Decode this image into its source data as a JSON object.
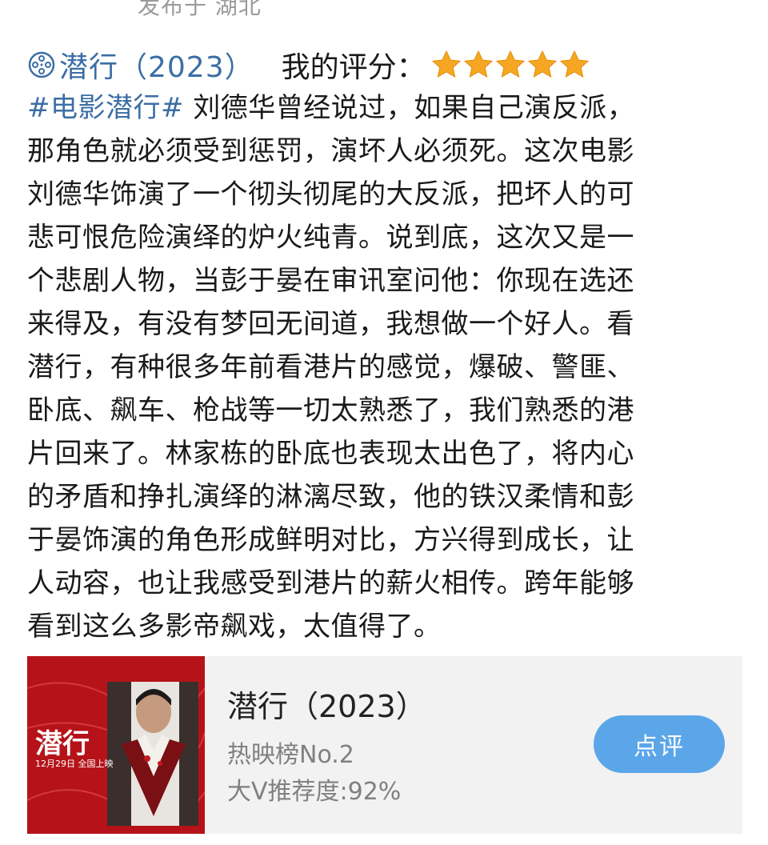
{
  "header": {
    "posted_from": "发布于 湖北"
  },
  "rating": {
    "film_icon": "film-reel-icon",
    "movie_link": "潜行（2023）",
    "score_label": "我的评分：",
    "stars": 5,
    "star_color": "#f5a623"
  },
  "post": {
    "hashtag": "#电影潜行#",
    "lines": [
      " 刘德华曾经说过，如果自己演反派，",
      "那角色就必须受到惩罚，演坏人必须死。这次电影",
      "刘德华饰演了一个彻头彻尾的大反派，把坏人的可",
      "悲可恨危险演绎的炉火纯青。说到底，这次又是一",
      "个悲剧人物，当彭于晏在审讯室问他：你现在选还",
      "来得及，有没有梦回无间道，我想做一个好人。看",
      "潜行，有种很多年前看港片的感觉，爆破、警匪、",
      "卧底、飙车、枪战等一切太熟悉了，我们熟悉的港",
      "片回来了。林家栋的卧底也表现太出色了，将内心",
      "的矛盾和挣扎演绎的淋漓尽致，他的铁汉柔情和彭",
      "于晏饰演的角色形成鲜明对比，方兴得到成长，让",
      "人动容，也让我感受到港片的薪火相传。跨年能够",
      "看到这么多影帝飙戏，太值得了。"
    ]
  },
  "card": {
    "poster_title": "潜行",
    "poster_date": "12月29日 全国上映",
    "title": "潜行（2023）",
    "rank": "热映榜No.2",
    "recommend": "大V推荐度:92%",
    "button_label": "点评",
    "button_color": "#5ba6e8"
  }
}
